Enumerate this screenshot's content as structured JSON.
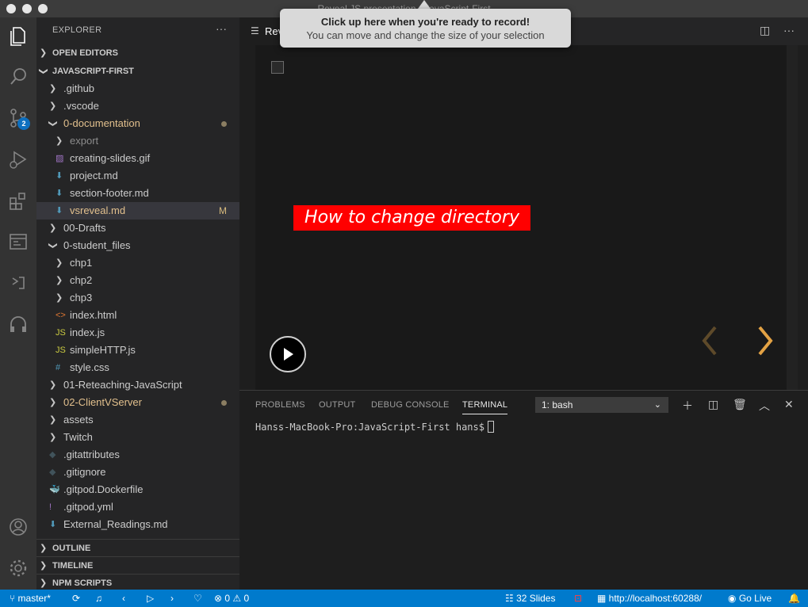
{
  "window": {
    "title": "Reveal JS presentation - JavaScript-First"
  },
  "recording_tooltip": {
    "title": "Click up here when you're ready to record!",
    "subtitle": "You can move and change the size of your selection"
  },
  "activity_bar": {
    "icons": [
      "files-icon",
      "search-icon",
      "source-control-icon",
      "run-debug-icon",
      "extensions-icon",
      "remote-explorer-icon",
      "live-share-icon",
      "headphones-icon",
      "account-icon",
      "settings-gear-icon"
    ],
    "scm_badge": "2"
  },
  "sidebar": {
    "header": "EXPLORER",
    "more": "···",
    "sections": {
      "open_editors": "OPEN EDITORS",
      "project": "JAVASCRIPT-FIRST",
      "outline": "OUTLINE",
      "timeline": "TIMELINE",
      "npm_scripts": "NPM SCRIPTS"
    },
    "tree": [
      {
        "label": ".github",
        "kind": "folder"
      },
      {
        "label": ".vscode",
        "kind": "folder"
      },
      {
        "label": "0-documentation",
        "kind": "folder-open"
      },
      {
        "label": "export",
        "kind": "folder"
      },
      {
        "label": "creating-slides.gif",
        "kind": "image"
      },
      {
        "label": "project.md",
        "kind": "markdown"
      },
      {
        "label": "section-footer.md",
        "kind": "markdown"
      },
      {
        "label": "vsreveal.md",
        "kind": "markdown",
        "status": "M"
      },
      {
        "label": "00-Drafts",
        "kind": "folder"
      },
      {
        "label": "0-student_files",
        "kind": "folder-open"
      },
      {
        "label": "chp1",
        "kind": "folder"
      },
      {
        "label": "chp2",
        "kind": "folder"
      },
      {
        "label": "chp3",
        "kind": "folder"
      },
      {
        "label": "index.html",
        "kind": "html"
      },
      {
        "label": "index.js",
        "kind": "js"
      },
      {
        "label": "simpleHTTP.js",
        "kind": "js"
      },
      {
        "label": "style.css",
        "kind": "css"
      },
      {
        "label": "01-Reteaching-JavaScript",
        "kind": "folder"
      },
      {
        "label": "02-ClientVServer",
        "kind": "folder"
      },
      {
        "label": "assets",
        "kind": "folder"
      },
      {
        "label": "Twitch",
        "kind": "folder"
      },
      {
        "label": ".gitattributes",
        "kind": "git"
      },
      {
        "label": ".gitignore",
        "kind": "git"
      },
      {
        "label": ".gitpod.Dockerfile",
        "kind": "docker"
      },
      {
        "label": ".gitpod.yml",
        "kind": "yaml"
      },
      {
        "label": "External_Readings.md",
        "kind": "markdown"
      }
    ]
  },
  "editor": {
    "tab_label": "Reveal JS presentation",
    "slide": {
      "title": "How to change directory"
    }
  },
  "panel": {
    "tabs": [
      "PROBLEMS",
      "OUTPUT",
      "DEBUG CONSOLE",
      "TERMINAL"
    ],
    "active_tab": "TERMINAL",
    "terminal_select": "1: bash",
    "prompt": "Hanss-MacBook-Pro:JavaScript-First hans$"
  },
  "statusbar": {
    "branch": "master*",
    "problems_errors": "0",
    "problems_warnings": "0",
    "slides": "32 Slides",
    "server": "http://localhost:60288/",
    "go_live": "Go Live"
  },
  "colors": {
    "statusbar": "#007acc",
    "slide_title_bg": "#ff0000",
    "modified": "#e2c08d",
    "badge": "#0e70c0"
  }
}
